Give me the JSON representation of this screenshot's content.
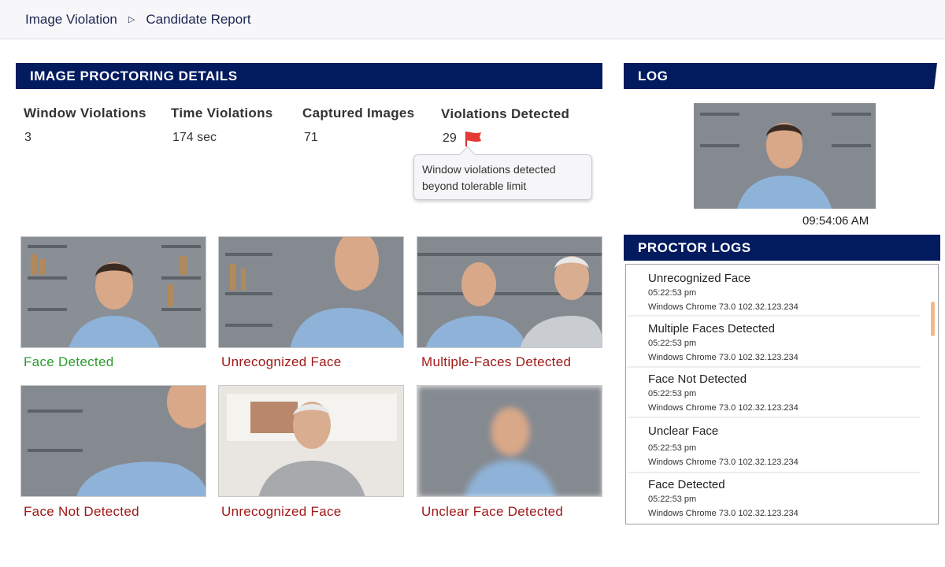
{
  "breadcrumb": {
    "root": "Image Violation",
    "current": "Candidate Report"
  },
  "details": {
    "title": "IMAGE PROCTORING DETAILS",
    "stats": [
      {
        "label": "Window Violations",
        "value": "3"
      },
      {
        "label": "Time Violations",
        "value": "174 sec"
      },
      {
        "label": "Captured Images",
        "value": "71"
      },
      {
        "label": "Violations Detected",
        "value": "29"
      }
    ],
    "tooltip": "Window violations detected beyond tolerable limit",
    "flag_color": "#e53935"
  },
  "captures": [
    {
      "caption": "Face Detected",
      "status": "ok"
    },
    {
      "caption": "Unrecognized Face",
      "status": "violation"
    },
    {
      "caption": "Multiple-Faces Detected",
      "status": "violation"
    },
    {
      "caption": "Face Not Detected",
      "status": "violation"
    },
    {
      "caption": "Unrecognized Face",
      "status": "violation"
    },
    {
      "caption": "Unclear Face Detected",
      "status": "violation"
    }
  ],
  "log": {
    "title": "LOG",
    "time": "09:54:06 AM"
  },
  "proctor_logs": {
    "title": "PROCTOR LOGS",
    "items": [
      {
        "title": "Unrecognized Face",
        "time": "05:22:53 pm",
        "device": "Windows Chrome 73.0 102.32.123.234"
      },
      {
        "title": "Multiple Faces Detected",
        "time": "05:22:53 pm",
        "device": "Windows Chrome 73.0 102.32.123.234"
      },
      {
        "title": "Face Not Detected",
        "time": "05:22:53 pm",
        "device": "Windows Chrome 73.0 102.32.123.234"
      },
      {
        "title": "Unclear Face",
        "time": "05:22:53 pm",
        "device": "Windows Chrome 73.0 102.32.123.234"
      },
      {
        "title": "Face Detected",
        "time": "05:22:53 pm",
        "device": "Windows Chrome 73.0 102.32.123.234"
      }
    ]
  },
  "colors": {
    "header_bg": "#021a5e",
    "ok": "#2e9b2e",
    "violation": "#a01818",
    "scroll": "#f2b98c"
  }
}
